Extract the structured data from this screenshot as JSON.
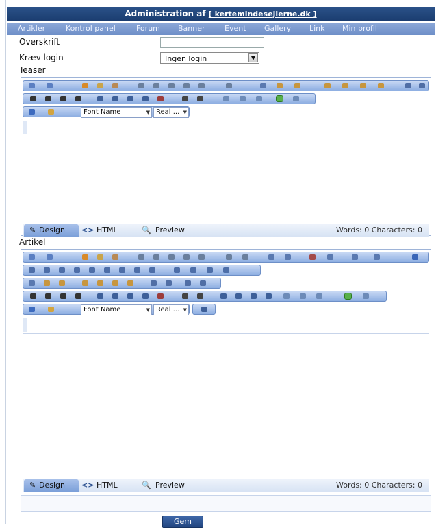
{
  "header": {
    "title": "Administration af",
    "site": "[ kertemindesejlerne.dk ]"
  },
  "nav": [
    "Artikler",
    "Kontrol panel",
    "Forum",
    "Banner",
    "Event",
    "Gallery",
    "Link",
    "Min profil"
  ],
  "form": {
    "headline_label": "Overskrift",
    "login_label": "Kræv login",
    "login_value": "Ingen login",
    "teaser_label": "Teaser",
    "article_label": "Artikel"
  },
  "editor": {
    "font_name": "Font Name",
    "font_size": "Real ...",
    "tab_design": "Design",
    "tab_html": "HTML",
    "tab_preview": "Preview",
    "teaser_stats": "Words: 0  Characters: 0",
    "article_stats": "Words: 0  Characters: 0"
  },
  "save_label": "Gem"
}
